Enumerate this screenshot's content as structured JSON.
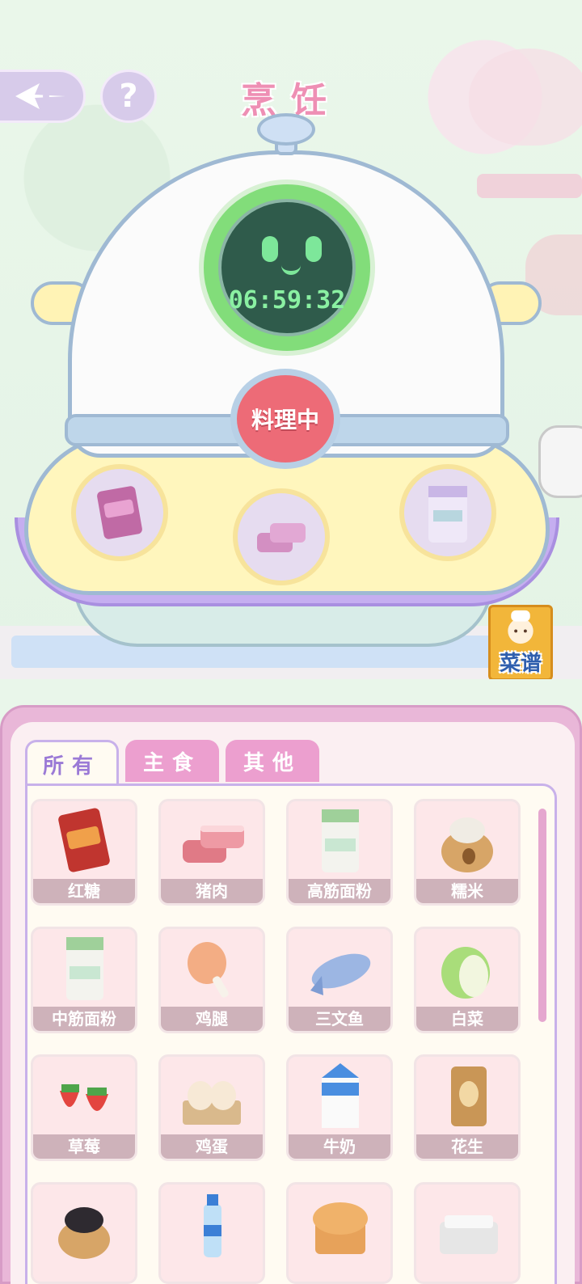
{
  "header": {
    "title": "烹饪",
    "help_label": "?"
  },
  "cooker": {
    "timer": "06:59:32",
    "status_button": "料理中",
    "slots": [
      "brown-sugar-icon",
      "pork-icon",
      "flour-icon"
    ]
  },
  "recipe_button": {
    "label": "菜谱"
  },
  "tabs": [
    {
      "label": "所有",
      "active": true
    },
    {
      "label": "主食",
      "active": false
    },
    {
      "label": "其他",
      "active": false
    }
  ],
  "ingredients": [
    {
      "name": "红糖",
      "icon": "brown-sugar-icon"
    },
    {
      "name": "猪肉",
      "icon": "pork-icon"
    },
    {
      "name": "高筋面粉",
      "icon": "flour-bag-icon"
    },
    {
      "name": "糯米",
      "icon": "rice-sack-icon"
    },
    {
      "name": "中筋面粉",
      "icon": "flour-bag-icon"
    },
    {
      "name": "鸡腿",
      "icon": "drumstick-icon"
    },
    {
      "name": "三文鱼",
      "icon": "salmon-icon"
    },
    {
      "name": "白菜",
      "icon": "cabbage-icon"
    },
    {
      "name": "草莓",
      "icon": "strawberry-icon"
    },
    {
      "name": "鸡蛋",
      "icon": "eggs-icon"
    },
    {
      "name": "牛奶",
      "icon": "milk-carton-icon"
    },
    {
      "name": "花生",
      "icon": "peanut-bag-icon"
    },
    {
      "name": "",
      "icon": "black-rice-sack-icon"
    },
    {
      "name": "",
      "icon": "water-bottle-icon"
    },
    {
      "name": "",
      "icon": "bread-icon"
    },
    {
      "name": "",
      "icon": "tofu-box-icon"
    }
  ]
}
